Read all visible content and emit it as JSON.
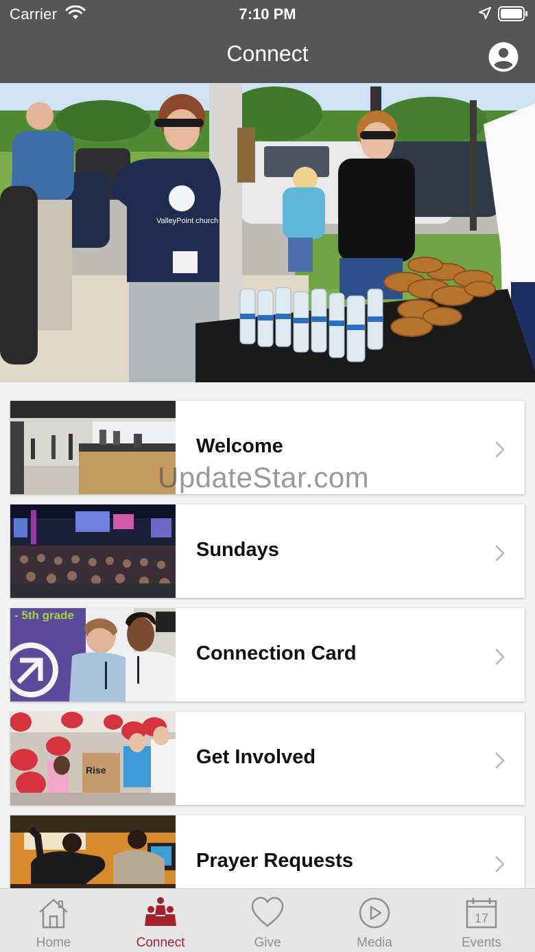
{
  "status_bar": {
    "carrier": "Carrier",
    "time": "7:10 PM"
  },
  "nav": {
    "title": "Connect"
  },
  "cards": [
    {
      "label": "Welcome",
      "icon": "chevron-right-icon"
    },
    {
      "label": "Sundays",
      "icon": "chevron-right-icon"
    },
    {
      "label": "Connection Card",
      "icon": "chevron-right-icon"
    },
    {
      "label": "Get Involved",
      "icon": "chevron-right-icon"
    },
    {
      "label": "Prayer Requests",
      "icon": "chevron-right-icon"
    }
  ],
  "thumb_text": {
    "grade": "- 5th grade",
    "rise": "Rise"
  },
  "hero_text": {
    "shirt": "ValleyPoint church"
  },
  "watermark": "UpdateStar.com",
  "tabs": [
    {
      "label": "Home",
      "icon": "home-icon",
      "active": false
    },
    {
      "label": "Connect",
      "icon": "people-icon",
      "active": true
    },
    {
      "label": "Give",
      "icon": "heart-icon",
      "active": false
    },
    {
      "label": "Media",
      "icon": "play-icon",
      "active": false
    },
    {
      "label": "Events",
      "icon": "calendar-icon",
      "active": false,
      "badge": "17"
    }
  ],
  "colors": {
    "bar": "#575656",
    "accent": "#a2232c",
    "tab_inactive": "#8e8e8e"
  }
}
